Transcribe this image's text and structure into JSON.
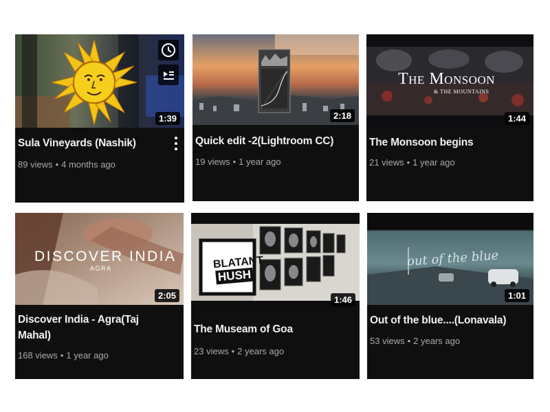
{
  "videos": [
    {
      "title": "Sula Vineyards (Nashik)",
      "views": "89 views",
      "age": "4 months ago",
      "duration": "1:39",
      "hover_icons": [
        "watch-later-icon",
        "add-to-queue-icon",
        "more-options-icon"
      ]
    },
    {
      "title": "Quick edit -2(Lightroom CC)",
      "views": "19 views",
      "age": "1 year ago",
      "duration": "2:18"
    },
    {
      "title": "The Monsoon begins",
      "views": "21 views",
      "age": "1 year ago",
      "duration": "1:44",
      "thumb_text": {
        "line1": "The Monsoon",
        "line2": "& THE MOUNTAINS"
      }
    },
    {
      "title": "Discover India - Agra(Taj Mahal)",
      "views": "168 views",
      "age": "1 year ago",
      "duration": "2:05",
      "thumb_text": {
        "line1": "DISCOVER INDIA",
        "line2": "AGRA"
      }
    },
    {
      "title": "The Museam of Goa",
      "views": "23 views",
      "age": "2 years ago",
      "duration": "1:46",
      "thumb_text": {
        "line1": "BLATANT",
        "line2": "HUSH"
      }
    },
    {
      "title": "Out of the blue....(Lonavala)",
      "views": "53 views",
      "age": "2 years ago",
      "duration": "1:01",
      "thumb_text": {
        "line1": "out of the blue"
      }
    }
  ],
  "meta_separator": "•",
  "colors": {
    "card_bg": "#0f0f0f",
    "title": "#f1f1f1",
    "meta": "#aaaaaa"
  }
}
